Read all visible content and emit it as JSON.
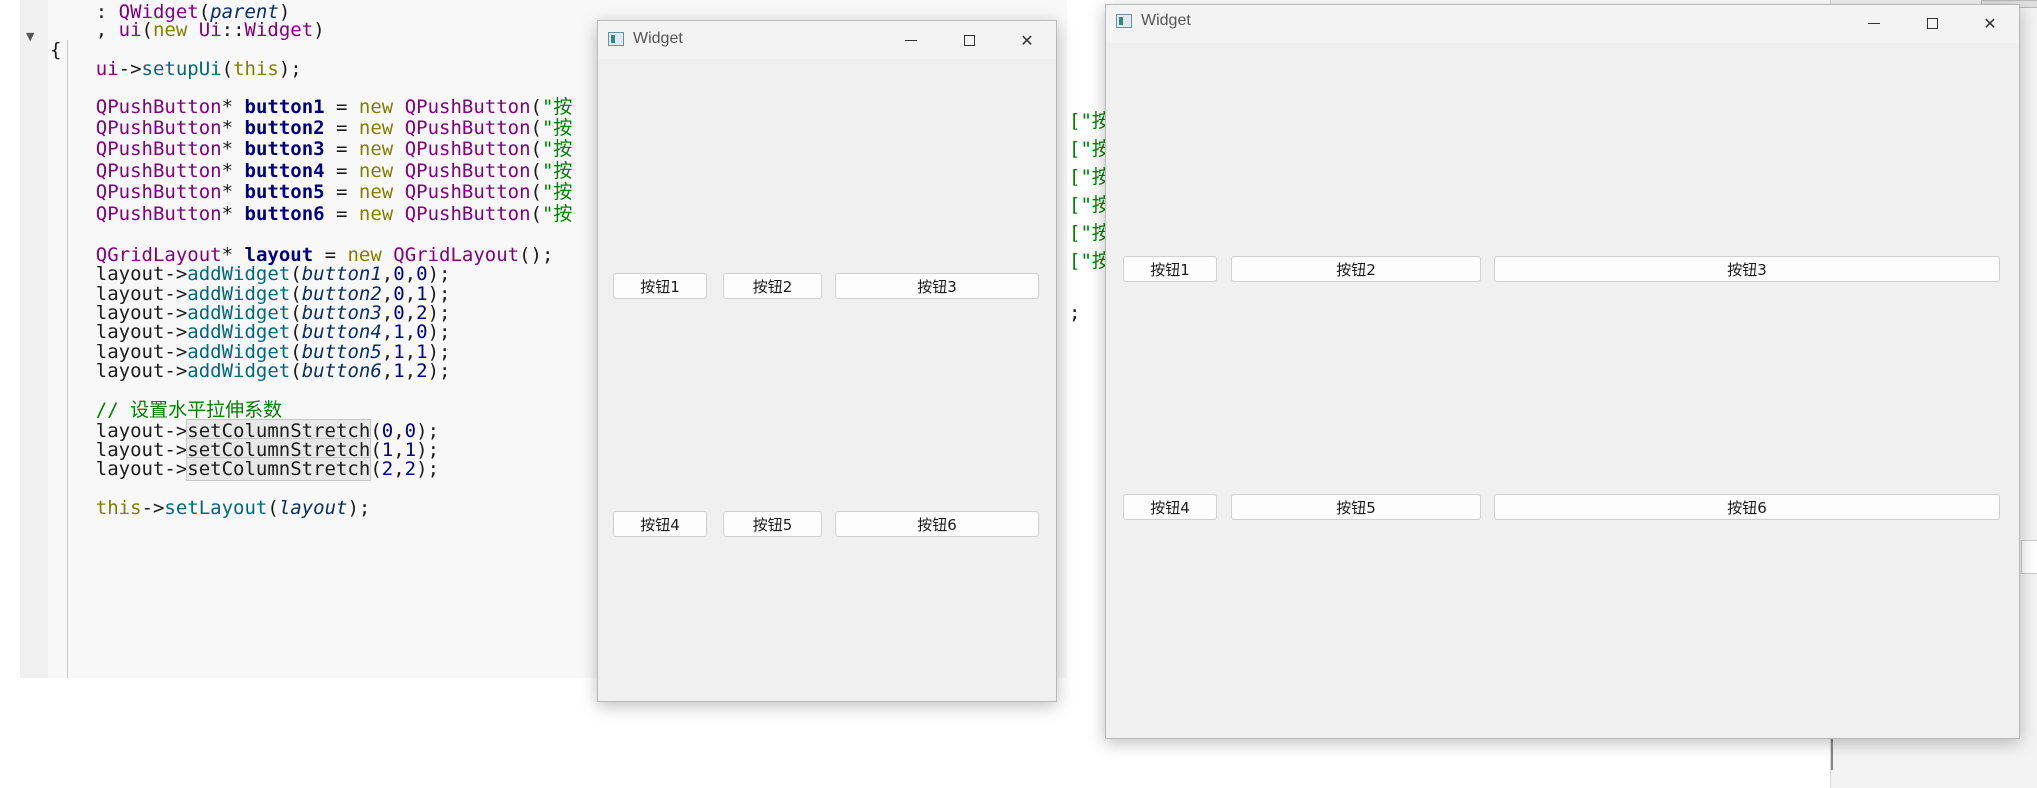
{
  "editor": {
    "lines": [
      [
        "    : ",
        {
          "t": "QWidget",
          "c": "ty"
        },
        "(",
        {
          "t": "parent",
          "c": "it"
        },
        ")"
      ],
      [
        "    , ",
        {
          "t": "ui",
          "c": "ty"
        },
        "(",
        {
          "t": "new",
          "c": "kw"
        },
        " ",
        {
          "t": "Ui",
          "c": "ty"
        },
        "::",
        {
          "t": "Widget",
          "c": "ty"
        },
        ")"
      ],
      [
        "{"
      ],
      [
        "    ",
        {
          "t": "ui",
          "c": "ty"
        },
        "->",
        {
          "t": "setupUi",
          "c": "fn"
        },
        "(",
        {
          "t": "this",
          "c": "kw"
        },
        ");"
      ],
      [
        ""
      ],
      [
        "    ",
        {
          "t": "QPushButton",
          "c": "ty"
        },
        "* ",
        {
          "t": "button1",
          "c": "b"
        },
        " = ",
        {
          "t": "new",
          "c": "kw"
        },
        " ",
        {
          "t": "QPushButton",
          "c": "ty"
        },
        "(",
        {
          "t": "\"按",
          "c": "st"
        }
      ],
      [
        "    ",
        {
          "t": "QPushButton",
          "c": "ty"
        },
        "* ",
        {
          "t": "button2",
          "c": "b"
        },
        " = ",
        {
          "t": "new",
          "c": "kw"
        },
        " ",
        {
          "t": "QPushButton",
          "c": "ty"
        },
        "(",
        {
          "t": "\"按",
          "c": "st"
        }
      ],
      [
        "    ",
        {
          "t": "QPushButton",
          "c": "ty"
        },
        "* ",
        {
          "t": "button3",
          "c": "b"
        },
        " = ",
        {
          "t": "new",
          "c": "kw"
        },
        " ",
        {
          "t": "QPushButton",
          "c": "ty"
        },
        "(",
        {
          "t": "\"按",
          "c": "st"
        }
      ],
      [
        "    ",
        {
          "t": "QPushButton",
          "c": "ty"
        },
        "* ",
        {
          "t": "button4",
          "c": "b"
        },
        " = ",
        {
          "t": "new",
          "c": "kw"
        },
        " ",
        {
          "t": "QPushButton",
          "c": "ty"
        },
        "(",
        {
          "t": "\"按",
          "c": "st"
        }
      ],
      [
        "    ",
        {
          "t": "QPushButton",
          "c": "ty"
        },
        "* ",
        {
          "t": "button5",
          "c": "b"
        },
        " = ",
        {
          "t": "new",
          "c": "kw"
        },
        " ",
        {
          "t": "QPushButton",
          "c": "ty"
        },
        "(",
        {
          "t": "\"按",
          "c": "st"
        }
      ],
      [
        "    ",
        {
          "t": "QPushButton",
          "c": "ty"
        },
        "* ",
        {
          "t": "button6",
          "c": "b"
        },
        " = ",
        {
          "t": "new",
          "c": "kw"
        },
        " ",
        {
          "t": "QPushButton",
          "c": "ty"
        },
        "(",
        {
          "t": "\"按",
          "c": "st"
        }
      ],
      [
        ""
      ],
      [
        "    ",
        {
          "t": "QGridLayout",
          "c": "ty"
        },
        "* ",
        {
          "t": "layout",
          "c": "b"
        },
        " = ",
        {
          "t": "new",
          "c": "kw"
        },
        " ",
        {
          "t": "QGridLayout",
          "c": "ty"
        },
        "();"
      ],
      [
        "    layout->",
        {
          "t": "addWidget",
          "c": "fn"
        },
        "(",
        {
          "t": "button1",
          "c": "it"
        },
        ",",
        {
          "t": "0",
          "c": "num"
        },
        ",",
        {
          "t": "0",
          "c": "num"
        },
        ");"
      ],
      [
        "    layout->",
        {
          "t": "addWidget",
          "c": "fn"
        },
        "(",
        {
          "t": "button2",
          "c": "it"
        },
        ",",
        {
          "t": "0",
          "c": "num"
        },
        ",",
        {
          "t": "1",
          "c": "num"
        },
        ");"
      ],
      [
        "    layout->",
        {
          "t": "addWidget",
          "c": "fn"
        },
        "(",
        {
          "t": "button3",
          "c": "it"
        },
        ",",
        {
          "t": "0",
          "c": "num"
        },
        ",",
        {
          "t": "2",
          "c": "num"
        },
        ");"
      ],
      [
        "    layout->",
        {
          "t": "addWidget",
          "c": "fn"
        },
        "(",
        {
          "t": "button4",
          "c": "it"
        },
        ",",
        {
          "t": "1",
          "c": "num"
        },
        ",",
        {
          "t": "0",
          "c": "num"
        },
        ");"
      ],
      [
        "    layout->",
        {
          "t": "addWidget",
          "c": "fn"
        },
        "(",
        {
          "t": "button5",
          "c": "it"
        },
        ",",
        {
          "t": "1",
          "c": "num"
        },
        ",",
        {
          "t": "1",
          "c": "num"
        },
        ");"
      ],
      [
        "    layout->",
        {
          "t": "addWidget",
          "c": "fn"
        },
        "(",
        {
          "t": "button6",
          "c": "it"
        },
        ",",
        {
          "t": "1",
          "c": "num"
        },
        ",",
        {
          "t": "2",
          "c": "num"
        },
        ");"
      ],
      [
        ""
      ],
      [
        "    ",
        {
          "t": "// 设置水平拉伸系数",
          "c": "cm"
        }
      ],
      [
        "    layout->",
        {
          "t": "setColumnStretch",
          "c": "hl"
        },
        "(",
        {
          "t": "0",
          "c": "num"
        },
        ",",
        {
          "t": "0",
          "c": "num"
        },
        ");"
      ],
      [
        "    layout->",
        {
          "t": "setColumnStretch",
          "c": "hl"
        },
        "(",
        {
          "t": "1",
          "c": "num"
        },
        ",",
        {
          "t": "1",
          "c": "num"
        },
        ");"
      ],
      [
        "    layout->",
        {
          "t": "setColumnStretch",
          "c": "hl"
        },
        "(",
        {
          "t": "2",
          "c": "num"
        },
        ",",
        {
          "t": "2",
          "c": "num"
        },
        ");"
      ],
      [
        ""
      ],
      [
        "    ",
        {
          "t": "this",
          "c": "kw"
        },
        "->",
        {
          "t": "setLayout",
          "c": "fn"
        },
        "(",
        {
          "t": "layout",
          "c": "it"
        },
        ");"
      ]
    ],
    "background_fragments": [
      "[\"按",
      "[\"按",
      "[\"按",
      "[\"按",
      "[\"按",
      "[\"按",
      ";"
    ]
  },
  "window_small": {
    "title": "Widget",
    "buttons": [
      "按钮1",
      "按钮2",
      "按钮3",
      "按钮4",
      "按钮5",
      "按钮6"
    ]
  },
  "window_large": {
    "title": "Widget",
    "buttons": [
      "按钮1",
      "按钮2",
      "按钮3",
      "按钮4",
      "按钮5",
      "按钮6"
    ]
  },
  "window_controls": {
    "minimize": "—",
    "maximize": "□",
    "close": "✕"
  }
}
